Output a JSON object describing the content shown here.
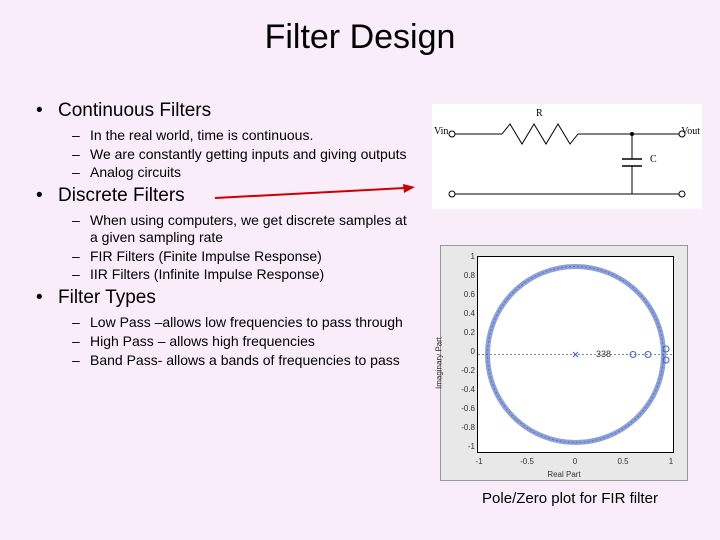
{
  "title": "Filter Design",
  "sections": [
    {
      "heading": "Continuous Filters",
      "items": [
        "In the real world, time is continuous.",
        "We are constantly getting inputs and giving outputs",
        "Analog circuits"
      ]
    },
    {
      "heading": "Discrete Filters",
      "items": [
        "When using computers, we get discrete samples at a given sampling rate",
        "FIR Filters (Finite Impulse Response)",
        "IIR Filters (Infinite Impulse Response)"
      ]
    },
    {
      "heading": "Filter Types",
      "items": [
        "Low Pass –allows low frequencies to pass through",
        "High Pass – allows high frequencies",
        "Band Pass- allows a bands of frequencies to pass"
      ]
    }
  ],
  "circuit": {
    "vin": "Vin",
    "vout": "Vout",
    "r": "R",
    "c": "C"
  },
  "plot": {
    "yticks": [
      "1",
      "0.8",
      "0.6",
      "0.4",
      "0.2",
      "0",
      "-0.2",
      "-0.4",
      "-0.6",
      "-0.8",
      "-1"
    ],
    "xticks": [
      "-1",
      "-0.5",
      "0",
      "0.5",
      "1"
    ],
    "xlabel": "Real Part",
    "ylabel": "Imaginary Part",
    "order_label": "338"
  },
  "caption": "Pole/Zero plot for FIR filter"
}
